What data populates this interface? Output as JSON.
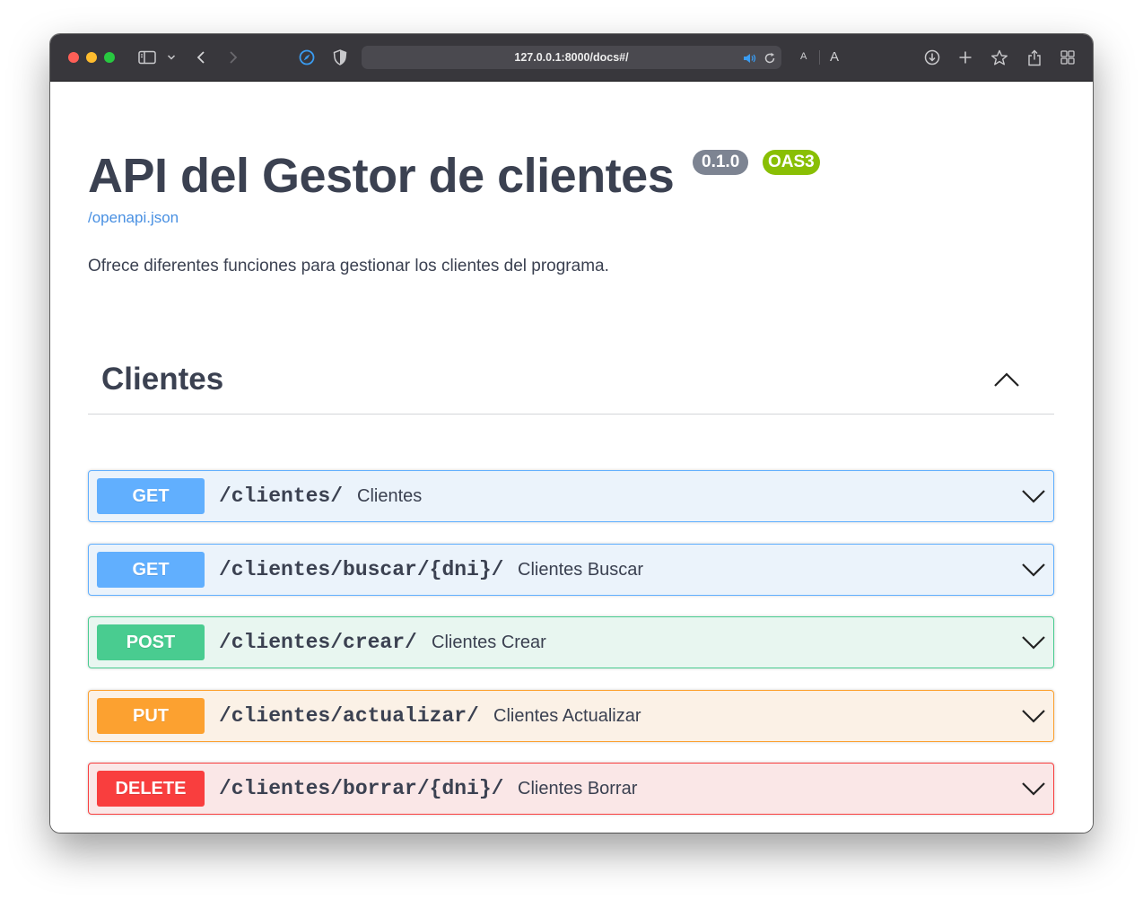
{
  "browser": {
    "url": "127.0.0.1:8000/docs#/",
    "font_small_label": "A",
    "font_large_label": "A"
  },
  "info": {
    "title": "API del Gestor de clientes",
    "version": "0.1.0",
    "oas_badge": "OAS3",
    "spec_link": "/openapi.json",
    "description": "Ofrece diferentes funciones para gestionar los clientes del programa."
  },
  "tag": {
    "name": "Clientes",
    "expanded": true
  },
  "colors": {
    "get": "#61affe",
    "get_bg": "#ebf3fb",
    "post": "#49cc90",
    "post_bg": "#e8f6f0",
    "put": "#fca130",
    "put_bg": "#fbf1e6",
    "delete": "#f93e3e",
    "delete_bg": "#fae7e7",
    "version_badge": "#7d8492",
    "oas_badge": "#89bf04",
    "link": "#4990e2"
  },
  "operations": [
    {
      "method": "GET",
      "path": "/clientes/",
      "summary": "Clientes"
    },
    {
      "method": "GET",
      "path": "/clientes/buscar/{dni}/",
      "summary": "Clientes Buscar"
    },
    {
      "method": "POST",
      "path": "/clientes/crear/",
      "summary": "Clientes Crear"
    },
    {
      "method": "PUT",
      "path": "/clientes/actualizar/",
      "summary": "Clientes Actualizar"
    },
    {
      "method": "DELETE",
      "path": "/clientes/borrar/{dni}/",
      "summary": "Clientes Borrar"
    }
  ],
  "icons": [
    "sidebar-icon",
    "chevron-down-icon",
    "back-icon",
    "forward-icon",
    "compass-icon",
    "shield-icon",
    "speaker-icon",
    "reload-icon",
    "download-icon",
    "plus-icon",
    "star-icon",
    "share-icon",
    "tabs-grid-icon",
    "chevron-up-icon"
  ]
}
